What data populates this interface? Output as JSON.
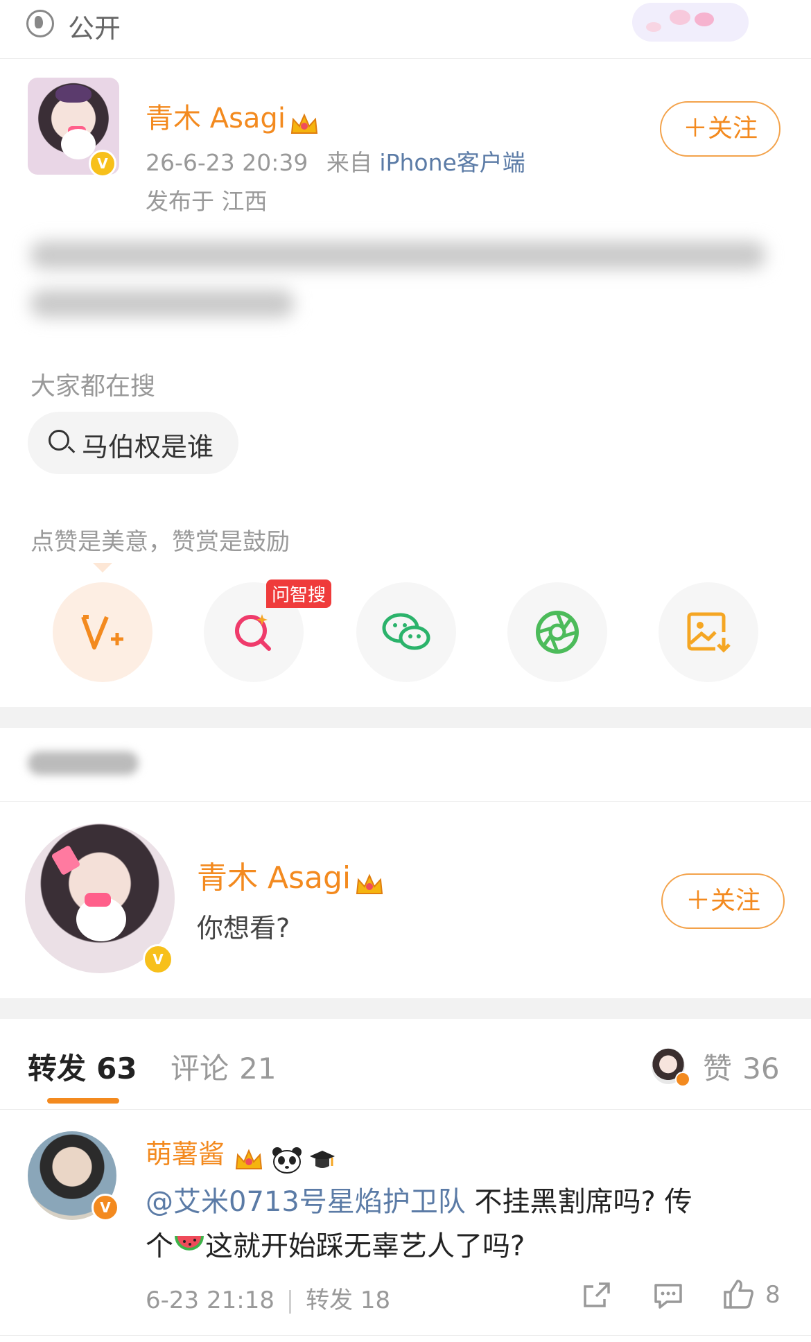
{
  "topbar": {
    "visibility_label": "公开",
    "globe_icon": "globe-icon",
    "sticker": "cloud-sticker"
  },
  "post": {
    "author": "青木 Asagi",
    "time": "26-6-23 20:39",
    "source_prefix": "来自",
    "source_name": "iPhone客户端",
    "location": "发布于 江西",
    "follow_label": "＋关注",
    "hot_search_heading": "大家都在搜",
    "hot_search_query": "马伯权是谁",
    "reward_heading": "点赞是美意，赞赏是鼓励",
    "share_tag": "问智搜",
    "share_icons": [
      "v-plus-icon",
      "ai-search-icon",
      "wechat-icon",
      "moments-icon",
      "save-image-icon"
    ]
  },
  "profile_card": {
    "name": "青木 Asagi",
    "bio": "你想看?",
    "follow_label": "＋关注"
  },
  "tabs": {
    "repost_label": "转发",
    "repost_count": "63",
    "comment_label": "评论",
    "comment_count": "21",
    "like_label": "赞",
    "like_count": "36"
  },
  "comment": {
    "author": "萌薯酱",
    "mention": "@艾米0713号星焰护卫队",
    "text_1": " 不挂黑割席吗? 传",
    "text_2_a": "个",
    "text_2_b": "这就开始踩无辜艺人了吗?",
    "time": "6-23 21:18",
    "repost_meta": "转发 18",
    "like_count": "8"
  },
  "colors": {
    "accent": "#f38a1f",
    "link": "#5b7ba6",
    "tag_red": "#ef3b3b"
  }
}
